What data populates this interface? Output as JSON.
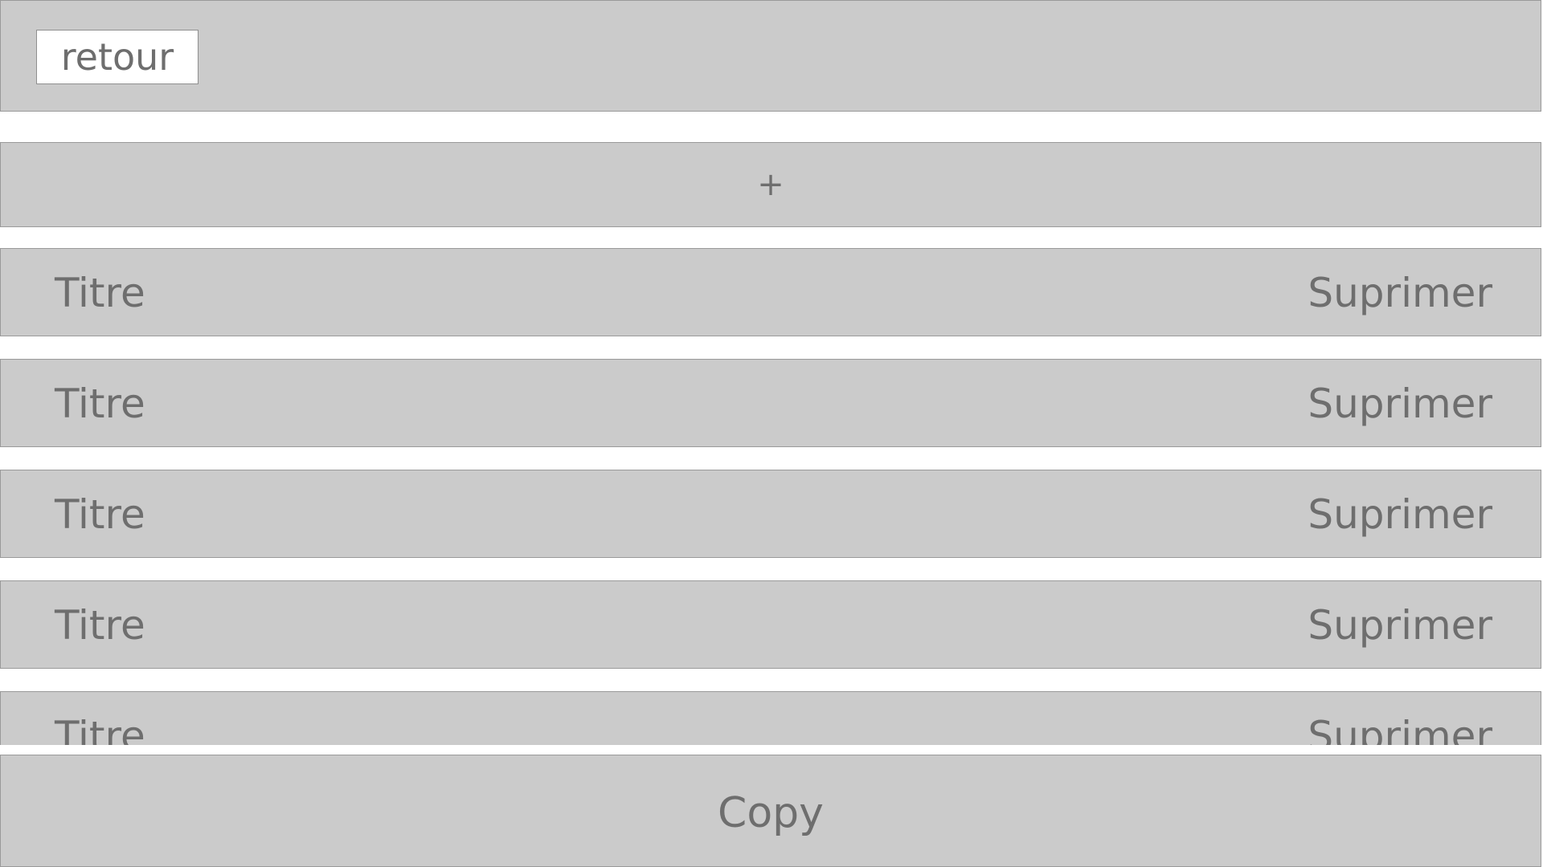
{
  "header": {
    "back_label": "retour"
  },
  "add_bar": {
    "label": "+"
  },
  "list": {
    "items": [
      {
        "title": "Titre",
        "delete_label": "Suprimer"
      },
      {
        "title": "Titre",
        "delete_label": "Suprimer"
      },
      {
        "title": "Titre",
        "delete_label": "Suprimer"
      },
      {
        "title": "Titre",
        "delete_label": "Suprimer"
      },
      {
        "title": "Titre",
        "delete_label": "Suprimer"
      }
    ]
  },
  "footer": {
    "copy_label": "Copy"
  },
  "colors": {
    "panel_bg": "#cbcbcb",
    "text": "#6e6e6e",
    "border": "#9a9a9a",
    "page_bg": "#ffffff"
  }
}
